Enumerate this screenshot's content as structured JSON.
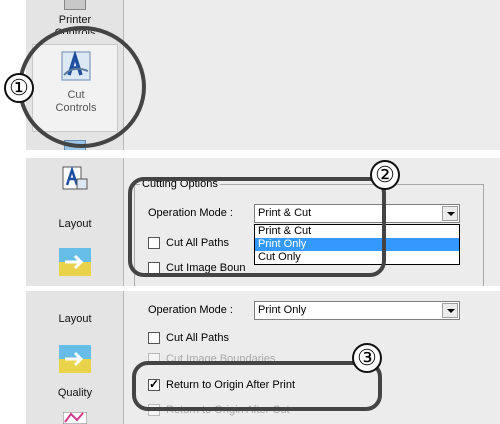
{
  "panel1": {
    "sidebar": {
      "printer_controls_label": "Printer\nControls",
      "cut_controls_label": "Cut\nControls"
    },
    "callout": "①"
  },
  "panel2": {
    "sidebar": {
      "layout_label": "Layout"
    },
    "group_title": "Cutting Options",
    "operation_mode_label": "Operation Mode :",
    "operation_mode_value": "Print & Cut",
    "options": [
      "Print & Cut",
      "Print Only",
      "Cut Only"
    ],
    "selected_option": "Print Only",
    "cut_all_paths_label": "Cut All Paths",
    "cut_image_boundaries_label": "Cut Image Boun",
    "callout": "②"
  },
  "panel3": {
    "sidebar": {
      "layout_label": "Layout",
      "quality_label": "Quality"
    },
    "operation_mode_label": "Operation Mode :",
    "operation_mode_value": "Print Only",
    "cut_all_paths_label": "Cut All Paths",
    "cut_image_boundaries_label": "Cut Image Boundaries",
    "return_to_origin_label": "Return to Origin After Print",
    "return_to_origin_checked": true,
    "return_to_origin_after_cut_label": "Return to Origin After Cut",
    "callout": "③"
  }
}
